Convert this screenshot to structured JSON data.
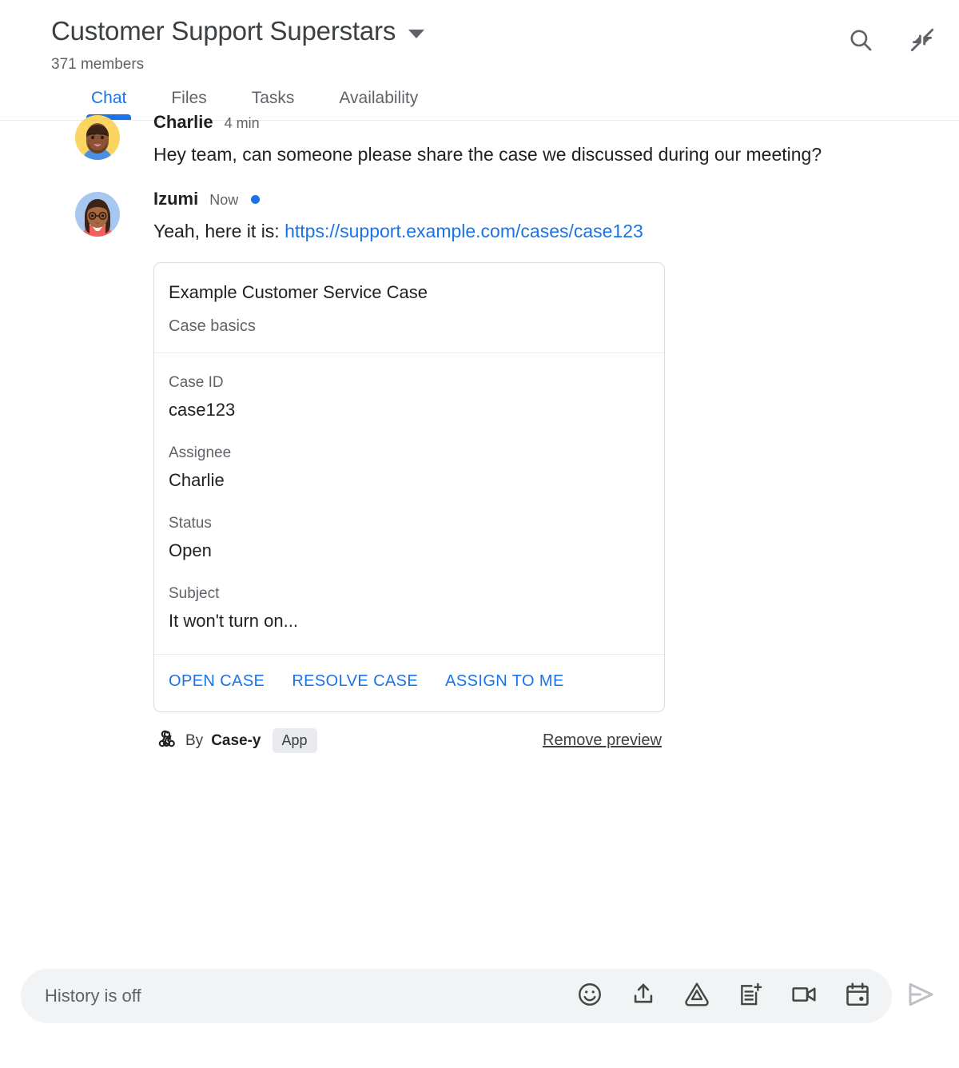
{
  "header": {
    "room_title": "Customer Support Superstars",
    "members": "371 members",
    "dropdown_icon": "chevron-down-icon",
    "search_icon": "search-icon",
    "collapse_icon": "collapse-icon"
  },
  "tabs": [
    {
      "label": "Chat",
      "active": true
    },
    {
      "label": "Files",
      "active": false
    },
    {
      "label": "Tasks",
      "active": false
    },
    {
      "label": "Availability",
      "active": false
    }
  ],
  "messages": [
    {
      "sender": "Charlie",
      "timestamp": "4 min",
      "unread": false,
      "text": "Hey team, can someone please share the case we discussed during our meeting?",
      "avatar": "charlie-avatar"
    },
    {
      "sender": "Izumi",
      "timestamp": "Now",
      "unread": true,
      "text_prefix": "Yeah, here it is: ",
      "link_text": "https://support.example.com/cases/case123",
      "avatar": "izumi-avatar"
    }
  ],
  "card": {
    "title": "Example Customer Service Case",
    "subtitle": "Case basics",
    "fields": [
      {
        "label": "Case ID",
        "value": "case123"
      },
      {
        "label": "Assignee",
        "value": "Charlie"
      },
      {
        "label": "Status",
        "value": "Open"
      },
      {
        "label": "Subject",
        "value": "It won't turn on..."
      }
    ],
    "actions": [
      "OPEN CASE",
      "RESOLVE CASE",
      "ASSIGN TO ME"
    ],
    "footer": {
      "app_icon": "webhook-icon",
      "by_text": "By",
      "app_name": "Case-y",
      "badge": "App",
      "remove_preview": "Remove preview"
    }
  },
  "composer": {
    "placeholder": "History is off",
    "icons": [
      "emoji-icon",
      "upload-icon",
      "google-drive-icon",
      "new-document-icon",
      "video-camera-icon",
      "calendar-icon"
    ],
    "send_icon": "send-icon"
  },
  "colors": {
    "accent": "#1a73e8",
    "text_primary": "#202124",
    "text_secondary": "#5f6368",
    "border": "#dadce0",
    "composer_bg": "#f1f3f4",
    "badge_bg": "#e8eaed"
  }
}
